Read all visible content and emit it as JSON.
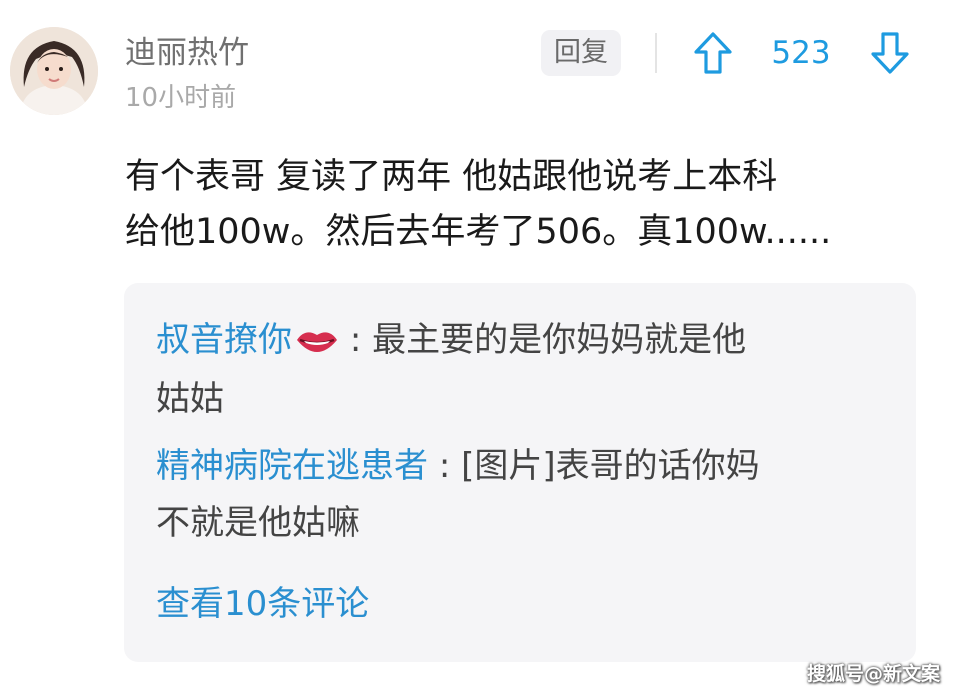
{
  "comment": {
    "username": "迪丽热竹",
    "timestamp": "10小时前",
    "reply_label": "回复",
    "vote_count": "523",
    "body_lines": [
      "有个表哥 复读了两年 他姑跟他说考上本科",
      "给他100w。然后去年考了506。真100w......"
    ]
  },
  "replies": [
    {
      "author": "叔音撩你",
      "author_emoji": "lips-icon",
      "separator": ":",
      "lines": [
        "最主要的是你妈妈就是他",
        "姑姑"
      ]
    },
    {
      "author": "精神病院在逃患者",
      "separator": ":",
      "lines": [
        "[图片]表哥的话你妈",
        "不就是他姑嘛"
      ]
    }
  ],
  "view_more_label": "查看10条评论",
  "watermark": "搜狐号@新文案",
  "colors": {
    "accent_blue": "#1e9be0",
    "link_blue": "#2a8fd0",
    "reply_bg": "#f5f5f7",
    "username_gray": "#707070",
    "time_gray": "#a9a9a9"
  }
}
